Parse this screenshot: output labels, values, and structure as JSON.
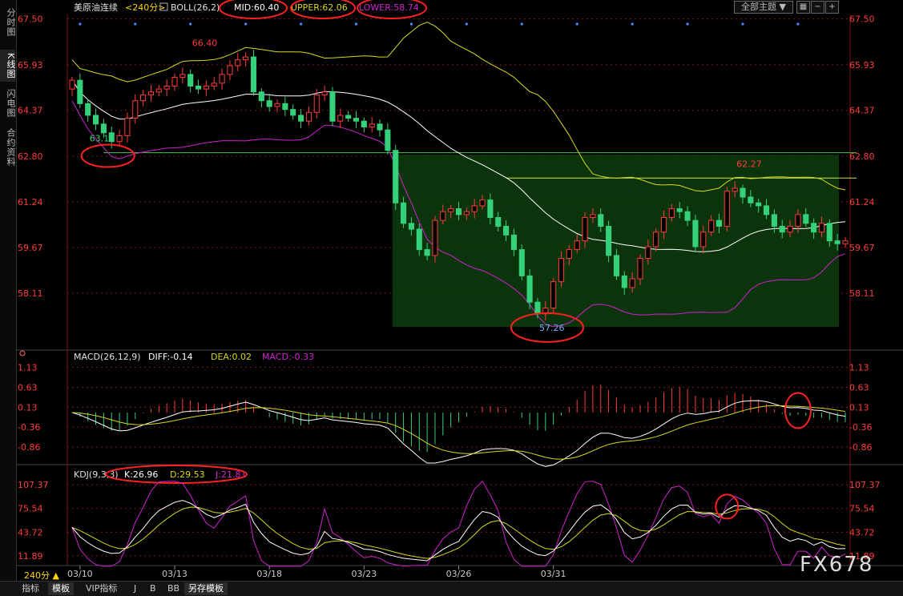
{
  "app": {
    "left_tabs": [
      "分时图",
      "K线图",
      "闪电图",
      "合约资料"
    ],
    "bottom_tabs": [
      "指标",
      "模板",
      "VIP指标",
      "J",
      "B",
      "BB",
      "另存模板"
    ],
    "theme_button": "全部主题",
    "watermark": "FX678",
    "period_label": "240分 ▲",
    "tool_icons": [
      "grid-icon",
      "minus-icon",
      "plus-icon"
    ]
  },
  "colors": {
    "up": "#ff3b3b",
    "down": "#35d07a",
    "mid": "#ffffff",
    "upper": "#d8d818",
    "lower": "#d020d0",
    "dif": "#ffffff",
    "dea": "#d8d818",
    "macd": "#d020d0",
    "axis_label": "#ff3b3b",
    "grid": "#7a1515",
    "box_fill": "#0d3a0d",
    "hline": "#49c449",
    "annotation_red": "#ff2020"
  },
  "chart_data": [
    {
      "type": "candlestick",
      "title": "美原油连续",
      "period": "<240分>",
      "indicator": "BOLL(26,2)",
      "legend": [
        {
          "text": "MID:60.40",
          "color": "#ffffff"
        },
        {
          "text": "UPPER:62.06",
          "color": "#d8d818"
        },
        {
          "text": "LOWER:58.74",
          "color": "#d020d0"
        }
      ],
      "y_ticks": [
        "67.50",
        "65.93",
        "64.37",
        "62.80",
        "61.24",
        "59.67",
        "58.11"
      ],
      "ylim": [
        56.9,
        67.6
      ],
      "x_ticks": [
        {
          "label": "03/10",
          "index": 1
        },
        {
          "label": "03/13",
          "index": 13
        },
        {
          "label": "03/18",
          "index": 25
        },
        {
          "label": "03/23",
          "index": 37
        },
        {
          "label": "03/26",
          "index": 49
        },
        {
          "label": "03/31",
          "index": 61
        }
      ],
      "closes": [
        65.4,
        64.6,
        64.2,
        63.9,
        63.6,
        63.3,
        63.5,
        64.1,
        64.7,
        64.9,
        65.0,
        65.1,
        65.2,
        65.5,
        65.6,
        65.2,
        65.1,
        65.2,
        65.3,
        65.6,
        65.9,
        66.1,
        66.2,
        65.0,
        64.7,
        64.5,
        64.6,
        64.4,
        64.2,
        64.0,
        64.3,
        64.9,
        65.0,
        64.0,
        64.2,
        64.1,
        64.0,
        63.8,
        63.9,
        63.7,
        63.0,
        61.2,
        60.5,
        60.3,
        59.6,
        59.4,
        60.6,
        60.9,
        61.0,
        60.8,
        60.9,
        61.1,
        61.3,
        60.7,
        60.4,
        60.1,
        59.6,
        58.7,
        57.8,
        57.4,
        57.6,
        58.5,
        59.3,
        59.6,
        59.9,
        60.7,
        60.8,
        60.4,
        59.4,
        58.7,
        58.3,
        58.6,
        59.3,
        59.7,
        60.2,
        60.7,
        61.0,
        60.9,
        60.6,
        59.7,
        60.2,
        60.6,
        60.4,
        61.6,
        61.7,
        61.4,
        61.2,
        61.1,
        60.8,
        60.4,
        60.2,
        60.4,
        60.8,
        60.5,
        60.2,
        60.5,
        59.9,
        59.8,
        59.9
      ],
      "annotations": [
        {
          "text": "66.40",
          "index": 15,
          "value": 66.4,
          "color": "#ff3b3b"
        },
        {
          "text": "63.14",
          "index": 2,
          "value": 63.14,
          "color": "#35d07a"
        },
        {
          "text": "57.26",
          "index": 59,
          "value": 57.26,
          "color": "#7aa7ff"
        },
        {
          "text": "62.27",
          "index": 84,
          "value": 62.27,
          "color": "#ff3b3b"
        }
      ]
    },
    {
      "type": "bar+line",
      "indicator": "MACD(26,12,9)",
      "legend": [
        {
          "text": "DIFF:-0.14",
          "color": "#ffffff"
        },
        {
          "text": "DEA:0.02",
          "color": "#d8d818"
        },
        {
          "text": "MACD:-0.33",
          "color": "#d020d0"
        }
      ],
      "y_ticks": [
        "1.13",
        "0.63",
        "0.13",
        "-0.36",
        "-0.86"
      ],
      "ylim": [
        -1.1,
        1.3
      ]
    },
    {
      "type": "line",
      "indicator": "KDJ(9,3,3)",
      "legend": [
        {
          "text": "K:26.96",
          "color": "#ffffff"
        },
        {
          "text": "D:29.53",
          "color": "#d8d818"
        },
        {
          "text": "J:21.81",
          "color": "#d020d0"
        }
      ],
      "y_ticks": [
        "107.37",
        "75.54",
        "43.72",
        "11.89"
      ],
      "ylim": [
        0,
        115
      ]
    }
  ]
}
